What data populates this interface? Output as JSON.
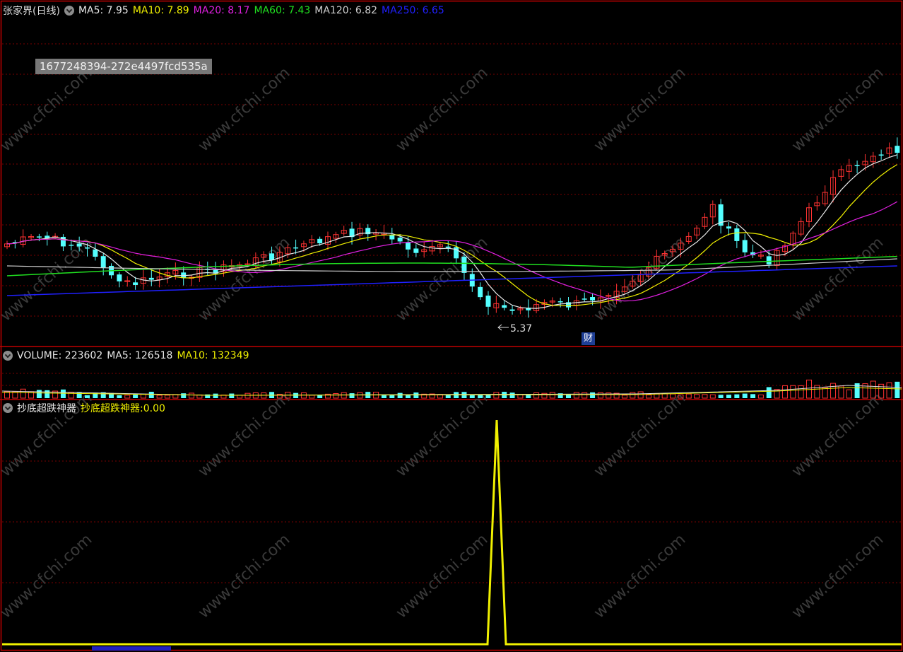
{
  "main_panel": {
    "stock_name": "张家界(日线)",
    "ma5": {
      "label": "MA5:",
      "value": "7.95",
      "color": "#e8e8e8"
    },
    "ma10": {
      "label": "MA10:",
      "value": "7.89",
      "color": "#f0f000"
    },
    "ma20": {
      "label": "MA20:",
      "value": "8.17",
      "color": "#e020e0"
    },
    "ma60": {
      "label": "MA60:",
      "value": "7.43",
      "color": "#20e020"
    },
    "ma120": {
      "label": "MA120:",
      "value": "6.82",
      "color": "#d0d0d0"
    },
    "ma250": {
      "label": "MA250:",
      "value": "6.65",
      "color": "#2020ff"
    },
    "id_stamp": "1677248394-272e4497fcd535a",
    "low_marker": "5.37",
    "finance_badge": "财"
  },
  "volume_panel": {
    "volume": {
      "label": "VOLUME:",
      "value": "223602"
    },
    "ma5": {
      "label": "MA5:",
      "value": "126518"
    },
    "ma10": {
      "label": "MA10:",
      "value": "132349"
    }
  },
  "indicator_panel": {
    "name": "抄底超跌神器",
    "line_label": "抄底超跌神器:",
    "line_value": "0.00",
    "color": "#f0f000"
  },
  "watermark": "www.cfchi.com",
  "colors": {
    "up": "#ff3232",
    "down": "#54ffff",
    "grid": "#7a0000",
    "border": "#c00000"
  },
  "chart_data": {
    "type": "candlestick",
    "low_annotation": 5.37,
    "indicator_signal": {
      "peak_at_fraction": 0.55,
      "baseline": 0.0
    }
  }
}
